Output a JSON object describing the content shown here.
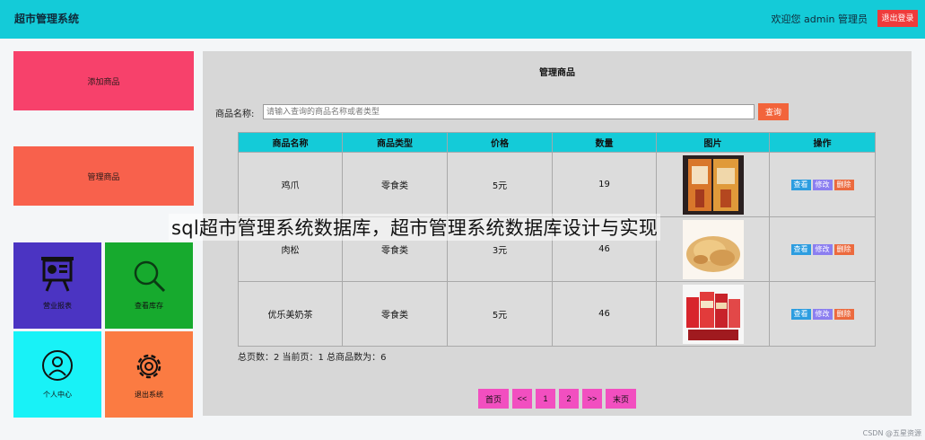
{
  "header": {
    "brand": "超市管理系统",
    "welcome": "欢迎您 admin 管理员",
    "logout_label": "退出登录"
  },
  "sidebar": {
    "add_label": "添加商品",
    "manage_label": "管理商品",
    "tiles": [
      {
        "label": "营业报表",
        "icon": "presentation-board-icon"
      },
      {
        "label": "查看库存",
        "icon": "magnifier-icon"
      },
      {
        "label": "个人中心",
        "icon": "user-circle-icon"
      },
      {
        "label": "退出系统",
        "icon": "gear-icon"
      }
    ]
  },
  "panel": {
    "title": "管理商品",
    "search_label": "商品名称:",
    "search_placeholder": "请输入查询的商品名称或者类型",
    "search_button": "查询"
  },
  "table": {
    "headers": [
      "商品名称",
      "商品类型",
      "价格",
      "数量",
      "图片",
      "操作"
    ],
    "rows": [
      {
        "name": "鸡爪",
        "type": "零食类",
        "price": "5元",
        "qty": "19",
        "image": "chicken-feet-product-photo"
      },
      {
        "name": "肉松",
        "type": "零食类",
        "price": "3元",
        "qty": "46",
        "image": "meat-floss-product-photo"
      },
      {
        "name": "优乐美奶茶",
        "type": "零食类",
        "price": "5元",
        "qty": "46",
        "image": "milk-tea-product-photo"
      }
    ],
    "actions": {
      "view": "查看",
      "edit": "修改",
      "delete": "删除"
    }
  },
  "summary": "总页数：2 当前页：1 总商品数为：6",
  "pager": {
    "first": "首页",
    "prev": "<<",
    "pages": [
      "1",
      "2"
    ],
    "next": ">>",
    "last": "末页"
  },
  "overlay_caption": "sql超市管理系统数据库，超市管理系统数据库设计与实现",
  "watermark": "CSDN @五星资源",
  "colors": {
    "header": "#14cbd8",
    "add": "#f7416b",
    "manage": "#f8614c",
    "tile_report": "#4b34c2",
    "tile_stock": "#17aa2e",
    "tile_profile": "#18f2f7",
    "tile_exit": "#fb7b42",
    "pager": "#f24fc0",
    "logout": "#ef3b3b"
  }
}
